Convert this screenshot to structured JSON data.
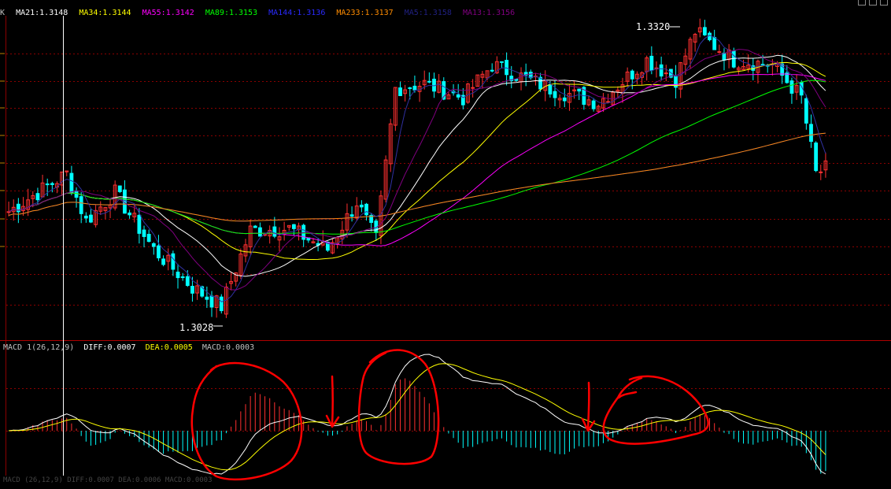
{
  "top_label": "",
  "legend": {
    "k_label": "K",
    "items": [
      {
        "text": "MA21:1.3148",
        "color": "#ffffff"
      },
      {
        "text": "MA34:1.3144",
        "color": "#ffff00"
      },
      {
        "text": "MA55:1.3142",
        "color": "#ff00ff"
      },
      {
        "text": "MA89:1.3153",
        "color": "#00ff00"
      },
      {
        "text": "MA144:1.3136",
        "color": "#0000ff"
      },
      {
        "text": "MA233:1.3137",
        "color": "#ff8c00"
      },
      {
        "text": "MA5:1.3158",
        "color": "#202080"
      },
      {
        "text": "MA13:1.3156",
        "color": "#800080"
      }
    ]
  },
  "macd_header": {
    "name": "MACD 1",
    "params": "(26,12,9)",
    "diff": "DIFF:0.0007",
    "dea": "DEA:0.0005",
    "macd": "MACD:0.0003"
  },
  "bottom_text": "MACD (26,12,9) DIFF:0.0007 DEA:0.0006 MACD:0.0003",
  "annotations": {
    "high_label": "1.3320",
    "low_label": "1.3028"
  },
  "colors": {
    "background": "#000000",
    "up_candle": "#ff3030",
    "down_candle": "#00ffff",
    "grid": "#8b0000",
    "hand_drawn": "#ff0000",
    "macd_pos": "#ff3030",
    "macd_neg": "#00ffff",
    "diff_line": "#ffffff",
    "dea_line": "#ffff00"
  },
  "chart_data": [
    {
      "type": "candlestick",
      "title": "",
      "price_range": [
        1.3,
        1.333
      ],
      "annotations": [
        {
          "text": "1.3320",
          "value": 1.332,
          "kind": "high"
        },
        {
          "text": "1.3028",
          "value": 1.3028,
          "kind": "low"
        }
      ],
      "bars_count": 170,
      "trend_points": [
        {
          "i": 0,
          "close": 1.313
        },
        {
          "i": 12,
          "close": 1.317
        },
        {
          "i": 16,
          "close": 1.312
        },
        {
          "i": 22,
          "close": 1.315
        },
        {
          "i": 30,
          "close": 1.309
        },
        {
          "i": 38,
          "close": 1.305
        },
        {
          "i": 44,
          "close": 1.303
        },
        {
          "i": 50,
          "close": 1.311
        },
        {
          "i": 58,
          "close": 1.3112
        },
        {
          "i": 66,
          "close": 1.309
        },
        {
          "i": 72,
          "close": 1.314
        },
        {
          "i": 76,
          "close": 1.31
        },
        {
          "i": 80,
          "close": 1.326
        },
        {
          "i": 86,
          "close": 1.3265
        },
        {
          "i": 94,
          "close": 1.325
        },
        {
          "i": 100,
          "close": 1.3285
        },
        {
          "i": 112,
          "close": 1.326
        },
        {
          "i": 122,
          "close": 1.3245
        },
        {
          "i": 132,
          "close": 1.329
        },
        {
          "i": 138,
          "close": 1.327
        },
        {
          "i": 142,
          "close": 1.332
        },
        {
          "i": 150,
          "close": 1.329
        },
        {
          "i": 158,
          "close": 1.3285
        },
        {
          "i": 164,
          "close": 1.325
        },
        {
          "i": 167,
          "close": 1.317
        },
        {
          "i": 169,
          "close": 1.3175
        }
      ],
      "moving_averages": [
        {
          "name": "MA21",
          "value": 1.3148,
          "color": "#ffffff"
        },
        {
          "name": "MA34",
          "value": 1.3144,
          "color": "#ffff00"
        },
        {
          "name": "MA55",
          "value": 1.3142,
          "color": "#ff00ff"
        },
        {
          "name": "MA89",
          "value": 1.3153,
          "color": "#00ff00"
        },
        {
          "name": "MA144",
          "value": 1.3136,
          "color": "#0000ff"
        },
        {
          "name": "MA233",
          "value": 1.3137,
          "color": "#ff8c00"
        },
        {
          "name": "MA5",
          "value": 1.3158,
          "color": "#202080"
        },
        {
          "name": "MA13",
          "value": 1.3156,
          "color": "#800080"
        }
      ],
      "grid": true
    },
    {
      "type": "bar",
      "title": "MACD 1 (26,12,9)",
      "series": [
        {
          "name": "DIFF",
          "last": 0.0007
        },
        {
          "name": "DEA",
          "last": 0.0005
        },
        {
          "name": "MACD",
          "last": 0.0003
        }
      ],
      "grid": true
    }
  ]
}
